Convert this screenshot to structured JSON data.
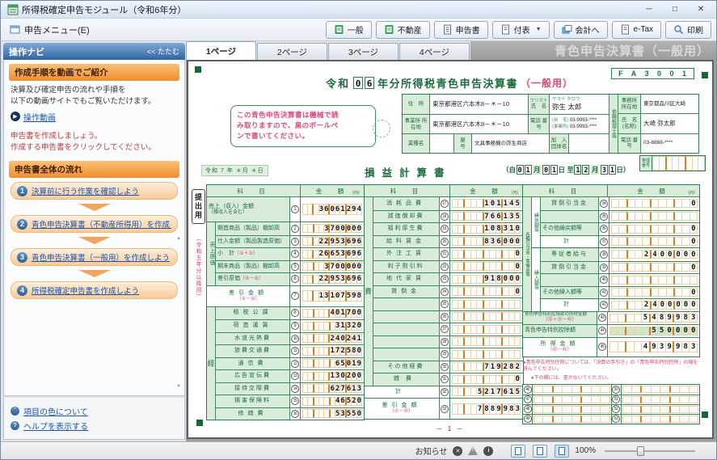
{
  "window": {
    "title": "所得税確定申告モジュール（令和6年分）",
    "minimize": "─",
    "maximize": "□",
    "close": "✕"
  },
  "menu": {
    "label": "申告メニュー(E)"
  },
  "toolbar": {
    "buttons": [
      "一般",
      "不動産",
      "申告書",
      "付表",
      "会計へ",
      "e-Tax",
      "印刷"
    ]
  },
  "sidebar": {
    "title": "操作ナビ",
    "collapse": "<< たたむ",
    "video_title": "作成手順を動画でご紹介",
    "video_line1": "決算及び確定申告の流れや手順を",
    "video_line2": "以下の動画サイトでもご覧いただけます。",
    "video_link": "操作動画",
    "inst1": "申告書を作成しましょう。",
    "inst2": "作成する申告書をクリックしてください。",
    "flow_title": "申告書全体の流れ",
    "steps": [
      {
        "num": "1",
        "label": "決算前に行う作業を確認しよう"
      },
      {
        "num": "2",
        "label": "青色申告決算書（不動産所得用）を作成しよう"
      },
      {
        "num": "3",
        "label": "青色申告決算書（一般用）を作成しよう"
      },
      {
        "num": "4",
        "label": "所得税確定申告書を作成しよう"
      }
    ],
    "footer_links": [
      "項目の色について",
      "ヘルプを表示する"
    ]
  },
  "tabs": {
    "items": [
      "1ページ",
      "2ページ",
      "3ページ",
      "4ページ"
    ],
    "active": "1ページ"
  },
  "header": {
    "title": "青色申告決算書（一般用）"
  },
  "form": {
    "code": "F A 3 0 0 1",
    "era": "令和",
    "year": "06",
    "title_main": "年分所得税青色申告決算書",
    "title_kakko": "（一般用）",
    "notice": [
      "この青色申告決算書は機械で読",
      "み取りますので、黒のボールペ",
      "ンで書いてください。"
    ],
    "info": {
      "address_label": "住　所",
      "address": "東京都港区六本木8－＊－10",
      "kana_label": "フリガナ",
      "kana": "ヤヨイ タロウ",
      "name_label": "氏　名",
      "name": "弥生 太郎",
      "office_label": "事業所 所在地",
      "office": "東京都港区六本木8－＊－10",
      "tel_label": "電話 番号",
      "tel_home_label": "(自　宅)",
      "tel_home": "03-9993-****",
      "tel_biz_label": "(事業所)",
      "tel_biz": "03-9993-****",
      "industry_label": "業種名",
      "industry": "",
      "yago_label": "屋　号",
      "yago": "文具事務機の弥生商店",
      "org_label": "加　入 団体名",
      "org": "",
      "tax": {
        "side": "依頼税理士等",
        "addr_label": "事務所 所在地",
        "addr": "東京都品川区大崎",
        "name_label": "氏　名 (名称)",
        "name": "大崎 弥太郎",
        "tel_label": "電話 番号",
        "tel": "03-8888-****"
      }
    },
    "submit_label": "提出用",
    "submit_sub": "（令和五年分以降用）",
    "date_note": "令和 7 年 ＊月 ＊日",
    "seiri_l1": "整理",
    "seiri_l2": "番号",
    "pl": {
      "title": "損益計算書",
      "head_subject": "科　目",
      "head_amount": "金　額",
      "unit": "（円）",
      "period": {
        "p0": "（自",
        "d1": "01",
        "p1": "月",
        "d2": "01",
        "p2": "日 至",
        "d3": "12",
        "p3": "月",
        "d4": "31",
        "p4": "日）"
      },
      "col1": {
        "sales": {
          "label": "売上（収入）金額",
          "label2": "（雑収入を含む）",
          "num": "1",
          "value": "36061294"
        },
        "cost_group": "売上原価",
        "cost_rows": [
          {
            "label": "期首商品（製品）棚卸高",
            "num": "2",
            "value": "3700000"
          },
          {
            "label": "仕入金額（製品製造原価）",
            "num": "3",
            "value": "22953696"
          },
          {
            "label": "小　計",
            "refin": "（②＋③）",
            "num": "4",
            "value": "26653696"
          },
          {
            "label": "期末商品（製品）棚卸高",
            "num": "5",
            "value": "3700000"
          },
          {
            "label": "差引原価",
            "refin": "（④－⑤）",
            "num": "6",
            "value": "22953696"
          }
        ],
        "diff": {
          "label": "差引金額",
          "ref": "（①－⑥）",
          "num": "7",
          "value": "13107598",
          "white": true
        },
        "exp_group": "経",
        "exp_rows": [
          {
            "label": "租税公課",
            "num": "8",
            "value": "401700"
          },
          {
            "label": "荷造運賃",
            "num": "9",
            "value": "31320"
          },
          {
            "label": "水道光熱費",
            "num": "10",
            "value": "240241"
          },
          {
            "label": "旅費交通費",
            "num": "11",
            "value": "172580"
          },
          {
            "label": "通信費",
            "num": "12",
            "value": "65019"
          },
          {
            "label": "広告宣伝費",
            "num": "13",
            "value": "130200"
          },
          {
            "label": "接待交際費",
            "num": "14",
            "value": "627613"
          },
          {
            "label": "損害保険料",
            "num": "15",
            "value": "46520"
          },
          {
            "label": "修繕費",
            "num": "16",
            "value": "53550"
          }
        ]
      },
      "col2": {
        "group": "費",
        "rows": [
          {
            "label": "消耗品費",
            "num": "17",
            "value": "101145"
          },
          {
            "label": "減価償却費",
            "num": "18",
            "value": "766135"
          },
          {
            "label": "福利厚生費",
            "num": "19",
            "value": "108310"
          },
          {
            "label": "給料賃金",
            "num": "20",
            "value": "836000"
          },
          {
            "label": "外注工賃",
            "num": "21",
            "value": "0"
          },
          {
            "label": "利子割引料",
            "num": "22",
            "value": "0"
          },
          {
            "label": "地代家賃",
            "num": "23",
            "value": "918000"
          },
          {
            "label": "貸倒金",
            "num": "24",
            "value": "0"
          },
          {
            "label": "",
            "num": "25",
            "value": ""
          },
          {
            "label": "",
            "num": "26",
            "value": ""
          },
          {
            "label": "",
            "num": "27",
            "value": ""
          },
          {
            "label": "",
            "num": "28",
            "value": ""
          },
          {
            "label": "",
            "num": "29",
            "value": ""
          },
          {
            "label": "その他経費",
            "num": "30",
            "value": "719282"
          },
          {
            "label": "雑費",
            "num": "31",
            "value": "0"
          }
        ],
        "total": {
          "label": "計",
          "num": "32",
          "value": "5217615",
          "white": true
        },
        "diff": {
          "label": "差引金額",
          "ref": "（⑦－㉜）",
          "num": "33",
          "value": "7889983",
          "white": true
        }
      },
      "col3": {
        "outer_group": "各種引当金・準備金等",
        "sub1": {
          "group": "繰戻額等",
          "rows": [
            {
              "label": "貸倒引当金",
              "num": "34",
              "value": "0"
            },
            {
              "label": "",
              "num": "35",
              "value": ""
            },
            {
              "label": "その他繰戻額等",
              "num": "36",
              "value": "0"
            },
            {
              "label": "計",
              "num": "37",
              "value": "0",
              "white": true
            }
          ]
        },
        "sub2": {
          "group": "繰入額等",
          "rows": [
            {
              "label": "専従者給与",
              "num": "38",
              "value": "2400000"
            },
            {
              "label": "貸倒引当金",
              "num": "39",
              "value": "0"
            },
            {
              "label": "",
              "num": "40",
              "value": ""
            },
            {
              "label": "その他繰入額等",
              "num": "41",
              "value": "0"
            },
            {
              "label": "計",
              "num": "42",
              "value": "2400000",
              "white": true
            }
          ]
        },
        "bottom": [
          {
            "label": "青色申告特別控除前の所得金額",
            "ref": "（㉝＋㊲－㊷）",
            "num": "43",
            "value": "5489983",
            "small": true
          },
          {
            "label": "青色申告特別控除額",
            "num": "44",
            "value": "550000",
            "tint": true
          },
          {
            "label": "所得金額",
            "ref": "（㊸－㊹）",
            "num": "45",
            "value": "4939983",
            "white": true
          }
        ]
      },
      "note1": "●青色申告特別控除については、「決算の手引き」の「青色申告特別控除」の項を読んでください。",
      "note2": "●下の欄には、書かないでください。",
      "blank_nums_left": [
        "46",
        "47",
        "48",
        "49"
      ],
      "blank_nums_right": [
        "50",
        "51",
        "52",
        "53"
      ]
    },
    "page_no": "－ 1 －"
  },
  "statusbar": {
    "notice": "お知らせ",
    "zoom": "100%"
  }
}
